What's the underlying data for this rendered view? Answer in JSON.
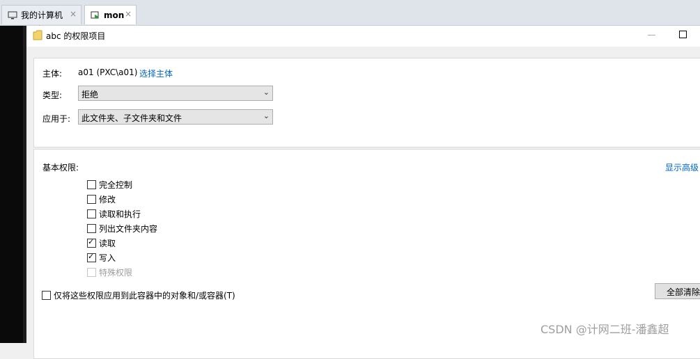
{
  "tabs": [
    {
      "label": "我的计算机",
      "icon": "monitor-icon",
      "close": "×"
    },
    {
      "label": "mon",
      "icon": "vm-play-icon",
      "close": "×"
    }
  ],
  "dialog": {
    "title": "abc 的权限项目",
    "principal_label": "主体:",
    "principal_value": "a01 (PXC\\a01)",
    "select_principal_link": "选择主体",
    "type_label": "类型:",
    "type_value": "拒绝",
    "applies_label": "应用于:",
    "applies_value": "此文件夹、子文件夹和文件",
    "basic_permissions_label": "基本权限:",
    "show_advanced_link": "显示高级",
    "permissions": [
      {
        "label": "完全控制",
        "checked": false,
        "disabled": false
      },
      {
        "label": "修改",
        "checked": false,
        "disabled": false
      },
      {
        "label": "读取和执行",
        "checked": false,
        "disabled": false
      },
      {
        "label": "列出文件夹内容",
        "checked": false,
        "disabled": false
      },
      {
        "label": "读取",
        "checked": true,
        "disabled": false
      },
      {
        "label": "写入",
        "checked": true,
        "disabled": false
      },
      {
        "label": "特殊权限",
        "checked": false,
        "disabled": true
      }
    ],
    "apply_only_checkbox": "仅将这些权限应用到此容器中的对象和/或容器(T)",
    "clear_all_button": "全部清除"
  },
  "watermark": "CSDN @计网二班-潘鑫超"
}
